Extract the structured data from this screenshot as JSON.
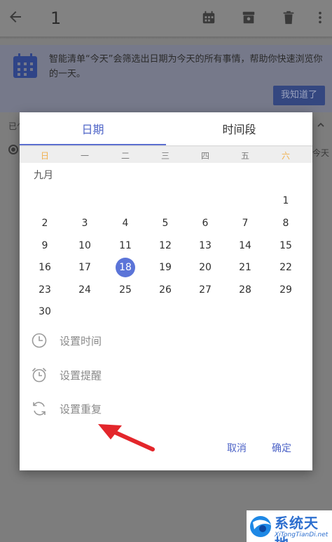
{
  "appbar": {
    "title": "1"
  },
  "tip": {
    "text": "智能清单“今天”会筛选出日期为今天的所有事情，帮助你快速浏览你的一天。",
    "button": "我知道了"
  },
  "list": {
    "group_label": "已ᐟ",
    "item_tag": "今天"
  },
  "dialog": {
    "tabs": {
      "date": "日期",
      "period": "时间段"
    },
    "weekdays": [
      "日",
      "一",
      "二",
      "三",
      "四",
      "五",
      "六"
    ],
    "month": "九月",
    "days": [
      "1",
      "2",
      "3",
      "4",
      "5",
      "6",
      "7",
      "8",
      "9",
      "10",
      "11",
      "12",
      "13",
      "14",
      "15",
      "16",
      "17",
      "18",
      "19",
      "20",
      "21",
      "22",
      "23",
      "24",
      "25",
      "26",
      "27",
      "28",
      "29",
      "30"
    ],
    "selected_day": "18",
    "options": {
      "time": "设置时间",
      "reminder": "设置提醒",
      "repeat": "设置重复"
    },
    "buttons": {
      "cancel": "取消",
      "ok": "确定"
    }
  },
  "watermark": {
    "cn": "系统天地",
    "en": "XiTongTianDi.net"
  },
  "colors": {
    "accent": "#5b74d8",
    "weekend": "#f1b04c",
    "arrow": "#e3262b"
  }
}
